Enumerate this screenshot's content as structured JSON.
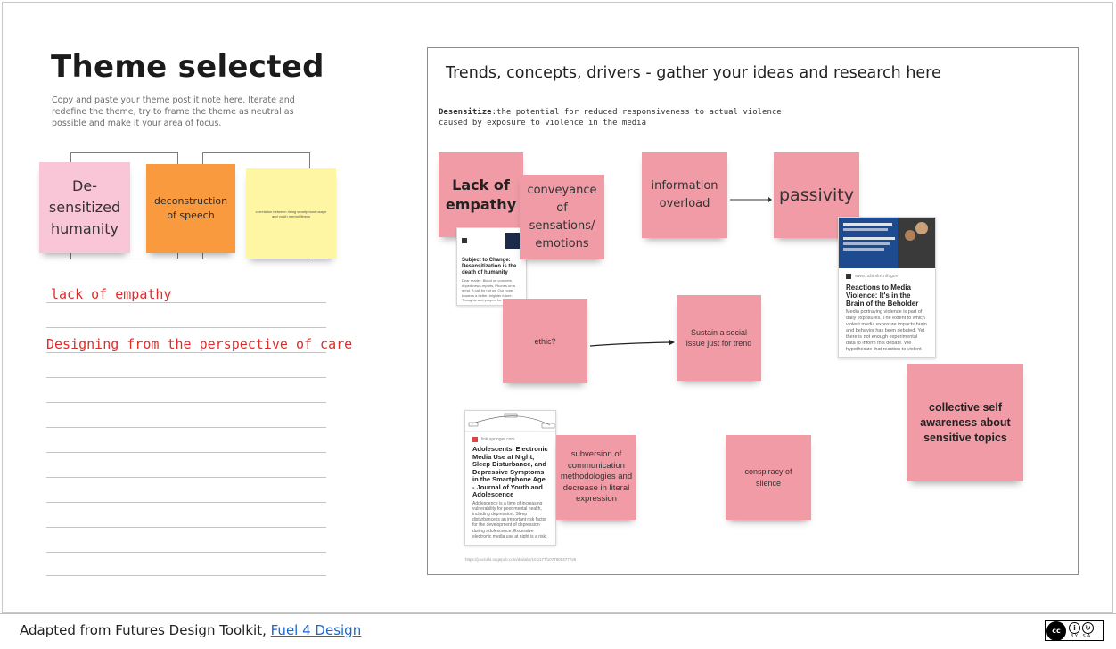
{
  "left_panel": {
    "title": "Theme selected",
    "subtitle": "Copy and paste your theme post it note here. Iterate and redefine the theme, try to frame the theme as neutral as possible and make it your area of focus.",
    "stickies": [
      {
        "text": "De-sensitized humanity",
        "color": "#f9c6d8"
      },
      {
        "text": "deconstruction of speech",
        "color": "#f99a3f"
      },
      {
        "text": "correlation between rising smartphone usage and youth mental illness",
        "color": "#fff6a3"
      }
    ],
    "notes": [
      "lack of empathy",
      "Designing from the perspective of care"
    ]
  },
  "board": {
    "title": "Trends, concepts, drivers - gather your ideas and research here",
    "definition_term": "Desensitize",
    "definition_text": ":the potential for reduced responsiveness to actual violence caused by exposure to violence in the media",
    "sticky_color": "#f09ba6",
    "stickies": [
      {
        "text": "Lack of empathy"
      },
      {
        "text": "conveyance of sensations/ emotions"
      },
      {
        "text": "information overload"
      },
      {
        "text": "passivity"
      },
      {
        "text": "ethic?"
      },
      {
        "text": "Sustain a social issue just for trend"
      },
      {
        "text": "collective self awareness about sensitive topics"
      },
      {
        "text": "subversion of communication methodologies and decrease in literal expression"
      },
      {
        "text": "conspiracy of silence"
      }
    ],
    "cards": [
      {
        "title": "Subject to Change: Desensitization is the death of humanity",
        "body": "Dear reader: Blood on concrete, ripped news reports. Phones on a grind. A call for not us. Our hope towards a better, brighter future. Thoughts and prayers for a loved week. Then headlines will begin to fade and one cycle for the situation ..."
      },
      {
        "source": "www.ncbi.nlm.nih.gov",
        "title": "Reactions to Media Violence: It's in the Brain of the Beholder",
        "body": "Media portraying violence is part of daily exposures. The extent to which violent media exposure impacts brain and behavior has been debated. Yet there is not enough experimental data to inform this debate. We hypothesize that reaction to violent media ..."
      },
      {
        "source": "link.springer.com",
        "title": "Adolescents' Electronic Media Use at Night, Sleep Disturbance, and Depressive Symptoms in the Smartphone Age - Journal of Youth and Adolescence",
        "body": "Adolescence is a time of increasing vulnerability for poor mental health, including depression. Sleep disturbance is an important risk factor for the development of depression during adolescence. Excessive electronic media use at night is a risk factor ..."
      }
    ],
    "small_link": "https://journals.sagepub.com/doi/abs/10.1177/1077800477?26"
  },
  "footer": {
    "text": "Adapted from Futures Design Toolkit, ",
    "link_text": "Fuel 4 Design",
    "license_logo": "cc",
    "license_labels": "BY SA"
  }
}
